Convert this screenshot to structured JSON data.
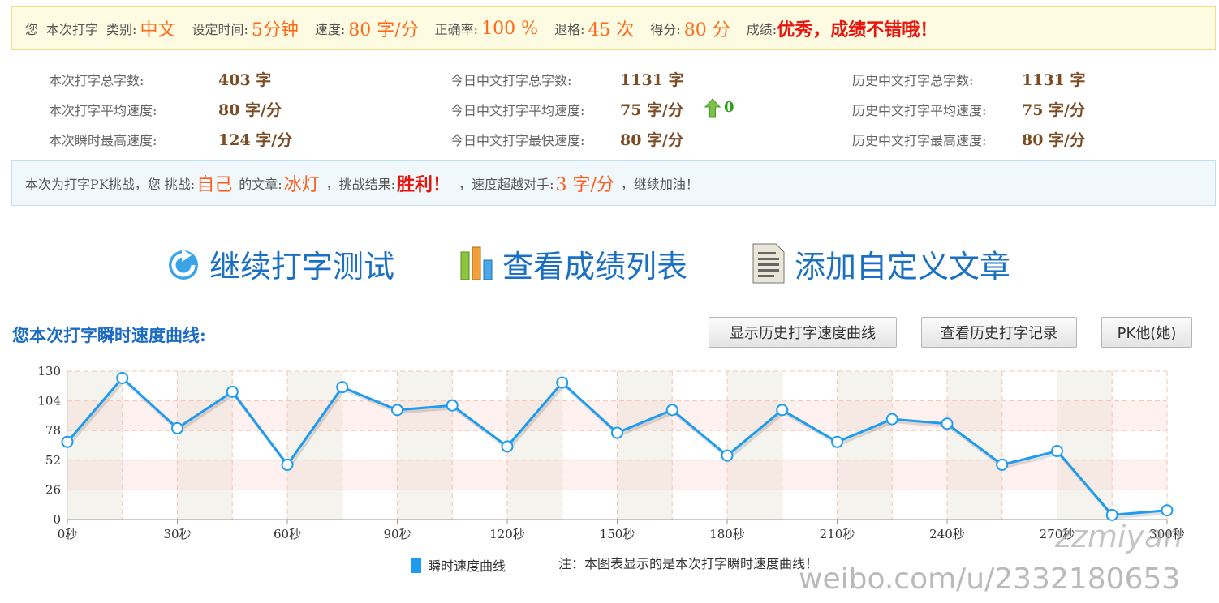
{
  "summary": {
    "you": "您",
    "this_typing": "本次打字",
    "category_label": "类别:",
    "category": "中文",
    "time_label": "设定时间:",
    "time": "5分钟",
    "speed_label": "速度:",
    "speed": "80 字/分",
    "accuracy_label": "正确率:",
    "accuracy": "100 %",
    "backspace_label": "退格:",
    "backspace": "45 次",
    "score_label": "得分:",
    "score": "80 分",
    "grade_label": "成绩:",
    "grade": "优秀，成绩不错哦！"
  },
  "stats": {
    "session": [
      {
        "label": "本次打字总字数:",
        "value": "403 字"
      },
      {
        "label": "本次打字平均速度:",
        "value": "80 字/分"
      },
      {
        "label": "本次瞬时最高速度:",
        "value": "124 字/分"
      }
    ],
    "today": [
      {
        "label": "今日中文打字总字数:",
        "value": "1131 字"
      },
      {
        "label": "今日中文打字平均速度:",
        "value": "75 字/分"
      },
      {
        "label": "今日中文打字最快速度:",
        "value": "80 字/分"
      }
    ],
    "history": [
      {
        "label": "历史中文打字总字数:",
        "value": "1131 字"
      },
      {
        "label": "历史中文打字平均速度:",
        "value": "75 字/分"
      },
      {
        "label": "历史中文打字最高速度:",
        "value": "80 字/分"
      }
    ],
    "today_avg_change": "0",
    "change_color": "#2e9e1a"
  },
  "pk": {
    "prefix": "本次为打字PK挑战，您 挑战:",
    "opponent": "自己",
    "article_label": "的文章:",
    "article": "冰灯",
    "result_label": "，挑战结果:",
    "result": "胜利！",
    "exceed_label": "，速度超越对手:",
    "exceed": "3 字/分",
    "suffix": "，继续加油！"
  },
  "actions": {
    "continue": "继续打字测试",
    "scores": "查看成绩列表",
    "add_article": "添加自定义文章"
  },
  "chart_section": {
    "title": "您本次打字瞬时速度曲线:",
    "btn_history_curve": "显示历史打字速度曲线",
    "btn_history_records": "查看历史打字记录",
    "btn_pk": "PK他(她)"
  },
  "chart_data": {
    "type": "line",
    "x_unit": "秒",
    "x_ticks": [
      0,
      30,
      60,
      90,
      120,
      150,
      180,
      210,
      240,
      270,
      300
    ],
    "x_tick_labels": [
      "0秒",
      "30秒",
      "60秒",
      "90秒",
      "120秒",
      "150秒",
      "180秒",
      "210秒",
      "240秒",
      "270秒",
      "300秒"
    ],
    "y_ticks": [
      0,
      26,
      52,
      78,
      104,
      130
    ],
    "ylim": [
      0,
      130
    ],
    "xlim": [
      0,
      300
    ],
    "series": [
      {
        "name": "瞬时速度曲线",
        "color": "#1e9cf0",
        "x": [
          0,
          15,
          30,
          45,
          60,
          75,
          90,
          105,
          120,
          135,
          150,
          165,
          180,
          195,
          210,
          225,
          240,
          255,
          270,
          285,
          300
        ],
        "y": [
          68,
          124,
          80,
          112,
          48,
          116,
          96,
          100,
          64,
          120,
          76,
          96,
          56,
          96,
          68,
          88,
          84,
          48,
          60,
          4,
          8
        ]
      }
    ],
    "legend_label": "瞬时速度曲线",
    "note": "注：本图表显示的是本次打字瞬时速度曲线！",
    "grid": true
  },
  "watermark": {
    "line1": "zzmiyan",
    "line2": "weibo.com/u/2332180653"
  }
}
